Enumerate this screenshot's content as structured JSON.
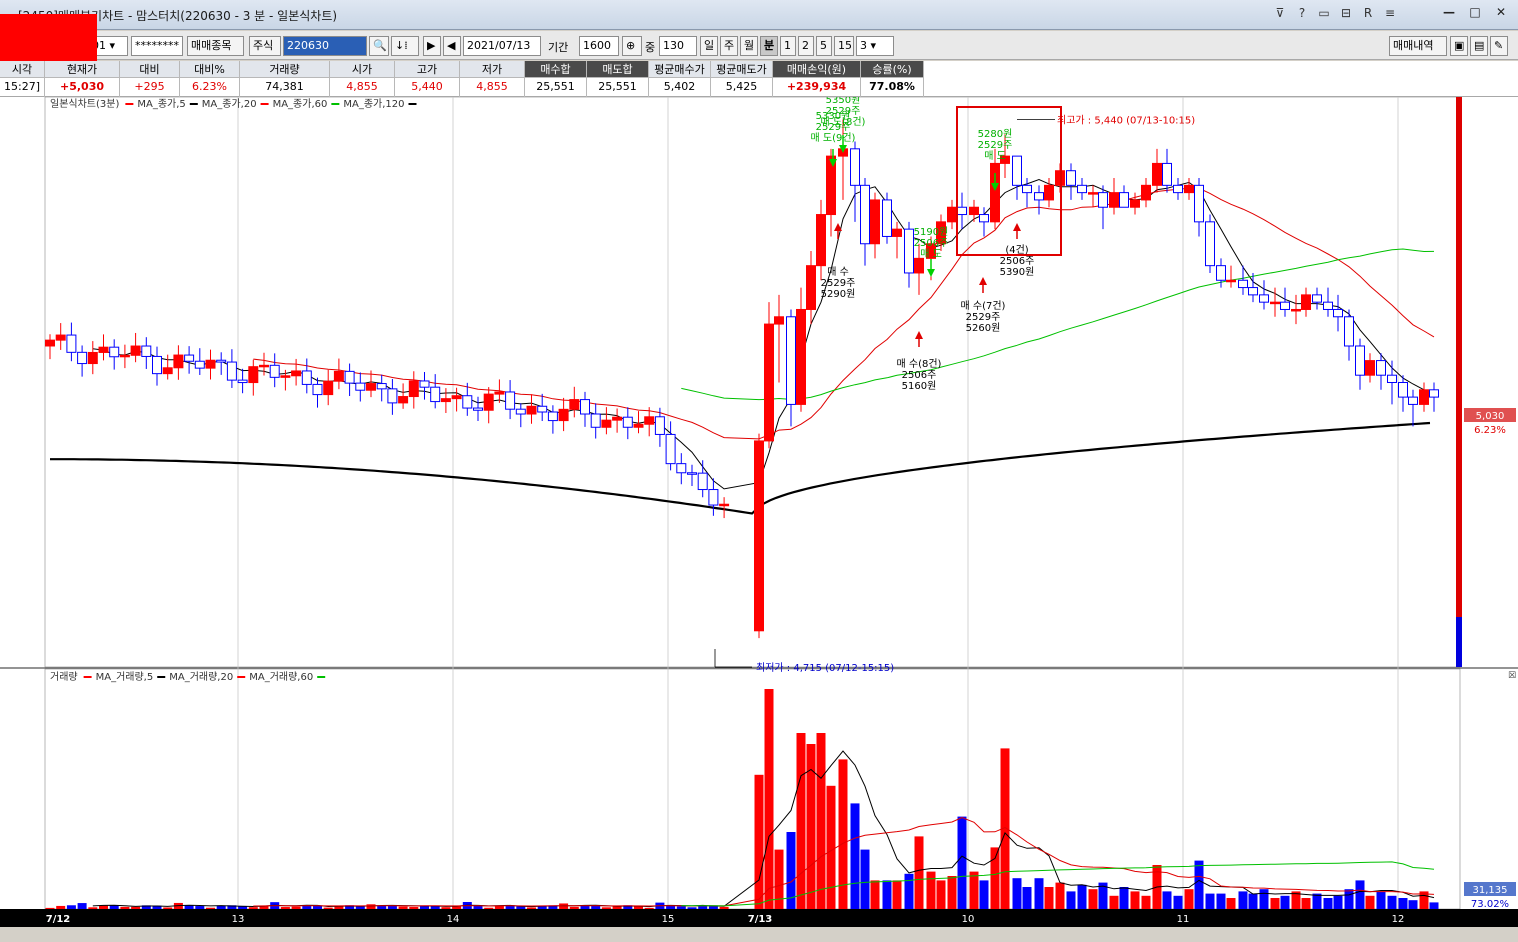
{
  "window": {
    "title": "[2450]매매분기차트 - 맘스터치(220630 - 3 분 - 일본식차트)",
    "icons": [
      "pin-icon",
      "help-icon",
      "window-icon",
      "restore-icon",
      "r-icon",
      "menu-icon"
    ],
    "controls": [
      "minimize",
      "maximize",
      "close"
    ]
  },
  "toolbar": {
    "account_suffix": "01",
    "password": "********",
    "trade_item_button": "매매종목",
    "market_select": "주식",
    "stock_code": "220630",
    "date": "2021/07/13",
    "period_label": "기간",
    "period_value": "1600",
    "count_label": "중",
    "count_value": "130",
    "period_buttons": [
      "일",
      "주",
      "월",
      "분",
      "1",
      "2",
      "5",
      "15"
    ],
    "period_active": "분",
    "custom_period": "3",
    "trade_history_button": "매매내역"
  },
  "info_bar": {
    "headers": [
      "시각",
      "현재가",
      "대비",
      "대비%",
      "거래량",
      "시가",
      "고가",
      "저가",
      "매수합",
      "매도합",
      "평균매수가",
      "평균매도가",
      "매매손익(원)",
      "승률(%)"
    ],
    "values": [
      "15:27]",
      "+5,030",
      "+295",
      "6.23%",
      "74,381",
      "4,855",
      "5,440",
      "4,855",
      "25,551",
      "25,551",
      "5,402",
      "5,425",
      "+239,934",
      "77.08%"
    ]
  },
  "price_panel": {
    "legend": "일본식차트(3분)",
    "legend_ma": [
      "MA_종가,5",
      "MA_종가,20",
      "MA_종가,60",
      "MA_종가,120"
    ],
    "legend_colors": [
      "#ff0000",
      "#000000",
      "#ff0000",
      "#00c000"
    ],
    "price_box": "5,030",
    "change_box": "6.23%",
    "high_label": "최고가 : 5,440 (07/13-10:15)",
    "low_label": "최저가 : 4,715 (07/12-15:15)",
    "trades": [
      {
        "type": "sell",
        "lines": [
          "5350원",
          "2529주",
          "매 도(8건)"
        ]
      },
      {
        "type": "sell",
        "lines": [
          "5330원",
          "2529주",
          "매 도(9건)"
        ]
      },
      {
        "type": "buy",
        "lines": [
          "매 수",
          "2529주",
          "5290원"
        ]
      },
      {
        "type": "sell",
        "lines": [
          "5190원",
          "2506주",
          "매 도"
        ]
      },
      {
        "type": "buy",
        "lines": [
          "매 수(8건)",
          "2506주",
          "5160원"
        ]
      },
      {
        "type": "sell",
        "lines": [
          "5280원",
          "2529주",
          "매 도"
        ]
      },
      {
        "type": "buy",
        "lines": [
          "매 수(7건)",
          "2529주",
          "5260원"
        ]
      },
      {
        "type": "buy",
        "lines": [
          "(4건)",
          "2506주",
          "5390원"
        ]
      }
    ]
  },
  "volume_panel": {
    "legend": "거래량",
    "legend_ma": [
      "MA_거래량,5",
      "MA_거래량,20",
      "MA_거래량,60"
    ],
    "legend_colors": [
      "#ff0000",
      "#000000",
      "#ff0000",
      "#00c000"
    ],
    "value_box": "31,135",
    "pct_box": "73.02%"
  },
  "x_axis": {
    "labels": [
      "7/12",
      "13",
      "14",
      "15",
      "7/13",
      "10",
      "11",
      "12"
    ]
  },
  "chart_data": {
    "type": "candlestick",
    "title": "",
    "ylim": [
      4700,
      5460
    ],
    "high": 5440,
    "low": 4715,
    "current": 5030
  }
}
